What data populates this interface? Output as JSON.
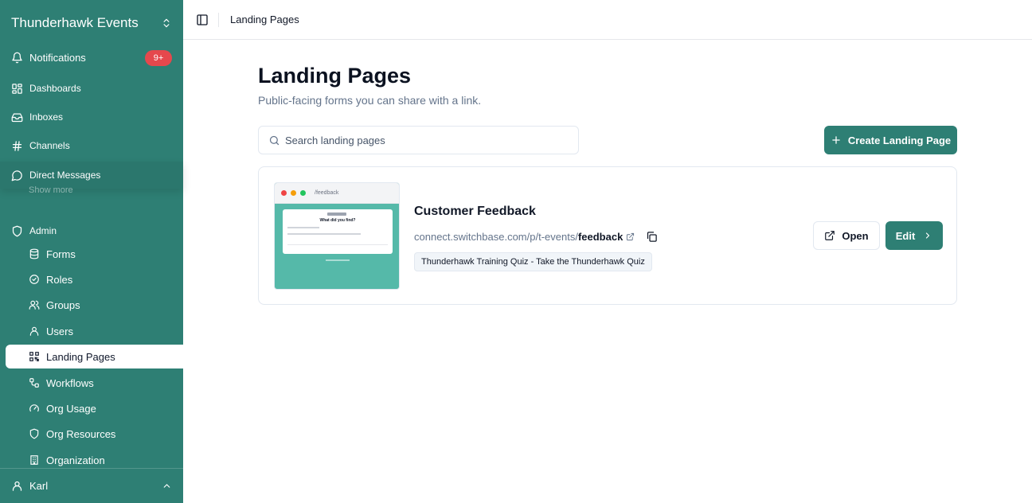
{
  "sidebar": {
    "org_name": "Thunderhawk Events",
    "notifications": {
      "label": "Notifications",
      "badge": "9+"
    },
    "items": [
      {
        "label": "Dashboards"
      },
      {
        "label": "Inboxes"
      },
      {
        "label": "Channels"
      },
      {
        "label": "Direct Messages"
      }
    ],
    "show_more": "Show more",
    "admin_label": "Admin",
    "admin_items": [
      {
        "label": "Forms"
      },
      {
        "label": "Roles"
      },
      {
        "label": "Groups"
      },
      {
        "label": "Users"
      },
      {
        "label": "Landing Pages"
      },
      {
        "label": "Workflows"
      },
      {
        "label": "Org Usage"
      },
      {
        "label": "Org Resources"
      },
      {
        "label": "Organization"
      }
    ],
    "active_item": "Landing Pages",
    "user_name": "Karl"
  },
  "header": {
    "breadcrumb": "Landing Pages"
  },
  "main": {
    "title": "Landing Pages",
    "subtitle": "Public-facing forms you can share with a link.",
    "search_placeholder": "Search landing pages",
    "create_label": "Create Landing Page",
    "landing_pages": [
      {
        "name": "Customer Feedback",
        "url_prefix": "connect.switchbase.com/p/t-events/",
        "slug": "feedback",
        "form_tag": "Thunderhawk Training Quiz - Take the Thunderhawk Quiz",
        "preview": {
          "url": "/feedback",
          "question": "What did you find?"
        },
        "open_label": "Open",
        "edit_label": "Edit"
      }
    ]
  },
  "colors": {
    "brand": "#2e7f74",
    "badge": "#e5484d",
    "preview_bg": "#55b9a9"
  }
}
